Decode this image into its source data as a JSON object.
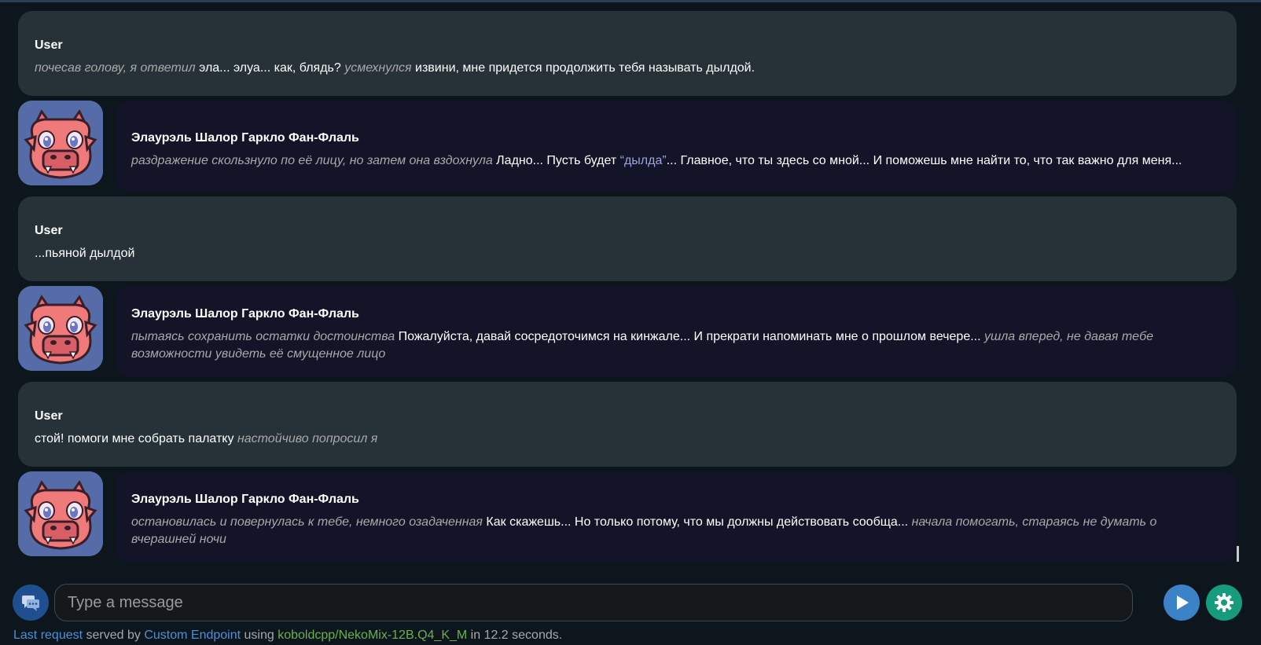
{
  "messages": [
    {
      "role": "user",
      "name": "User",
      "parts": [
        {
          "t": "em",
          "v": "почесав голову, я ответил"
        },
        {
          "t": "text",
          "v": " эла... элуа... как, блядь? "
        },
        {
          "t": "em",
          "v": "усмехнулся"
        },
        {
          "t": "text",
          "v": " извини, мне придется продолжить тебя называть дылдой."
        }
      ]
    },
    {
      "role": "ai",
      "name": "Элаурэль Шалор Гаркло Фан-Флаль",
      "parts": [
        {
          "t": "em",
          "v": "раздражение скользнуло по её лицу, но затем она вздохнула"
        },
        {
          "t": "text",
          "v": " Ладно... Пусть будет "
        },
        {
          "t": "quote",
          "v": "“дылда”"
        },
        {
          "t": "text",
          "v": "... Главное, что ты здесь со мной... И поможешь мне найти то, что так важно для меня..."
        }
      ]
    },
    {
      "role": "user",
      "name": "User",
      "parts": [
        {
          "t": "text",
          "v": "...пьяной дылдой"
        }
      ]
    },
    {
      "role": "ai",
      "name": "Элаурэль Шалор Гаркло Фан-Флаль",
      "parts": [
        {
          "t": "em",
          "v": "пытаясь сохранить остатки достоинства"
        },
        {
          "t": "text",
          "v": " Пожалуйста, давай сосредоточимся на кинжале... И прекрати напоминать мне о прошлом вечере... "
        },
        {
          "t": "em",
          "v": "ушла вперед, не давая тебе возможности увидеть её смущенное лицо"
        }
      ]
    },
    {
      "role": "user",
      "name": "User",
      "parts": [
        {
          "t": "text",
          "v": "стой! помоги мне собрать палатку "
        },
        {
          "t": "em",
          "v": "настойчиво попросил я"
        }
      ]
    },
    {
      "role": "ai",
      "name": "Элаурэль Шалор Гаркло Фан-Флаль",
      "parts": [
        {
          "t": "em",
          "v": "остановилась и повернулась к тебе, немного озадаченная"
        },
        {
          "t": "text",
          "v": " Как скажешь... Но только потому, что мы должны действовать сообща... "
        },
        {
          "t": "em",
          "v": "начала помогать, стараясь не думать о вчерашней ночи"
        }
      ]
    }
  ],
  "input": {
    "placeholder": "Type a message"
  },
  "status": {
    "last_request": "Last request",
    "served_by": " served by ",
    "endpoint": "Custom Endpoint",
    "using": " using ",
    "model": "koboldcpp/NekoMix-12B.Q4_K_M",
    "time": " in 12.2 seconds."
  },
  "icons": {
    "chat": "chat-bubbles-icon",
    "send": "play-send-icon",
    "settings": "gear-icon"
  },
  "colors": {
    "user_bubble": "#263238",
    "ai_bubble": "#131428",
    "accent_blue": "#3b82c6",
    "accent_green": "#169c7c"
  }
}
